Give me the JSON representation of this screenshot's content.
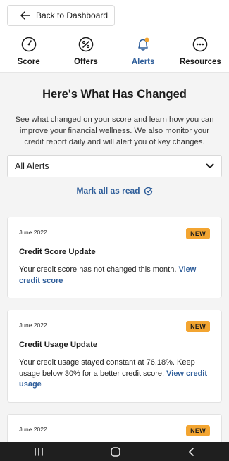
{
  "top": {
    "back_label": "Back to Dashboard"
  },
  "tabs": [
    {
      "label": "Score",
      "icon": "gauge-icon"
    },
    {
      "label": "Offers",
      "icon": "percent-icon"
    },
    {
      "label": "Alerts",
      "icon": "bell-icon",
      "active": true
    },
    {
      "label": "Resources",
      "icon": "more-dots-icon"
    }
  ],
  "main": {
    "heading": "Here's What Has Changed",
    "intro": "See what changed on your score and learn how you can improve your financial wellness. We also monitor your credit report daily and will alert you of key changes.",
    "filter_value": "All Alerts",
    "mark_all": "Mark all as read"
  },
  "cards": [
    {
      "date": "June 2022",
      "badge": "NEW",
      "title": "Credit Score Update",
      "body": "Your credit score has not changed this month.",
      "link": "View credit score"
    },
    {
      "date": "June 2022",
      "badge": "NEW",
      "title": "Credit Usage Update",
      "body": "Your credit usage stayed constant at 76.18%. Keep usage below 30% for a better credit score.",
      "link": "View credit usage"
    },
    {
      "date": "June 2022",
      "badge": "NEW"
    }
  ],
  "colors": {
    "accent": "#2f5e9a",
    "badge": "#f3a531",
    "notification_dot": "#f3a531"
  }
}
